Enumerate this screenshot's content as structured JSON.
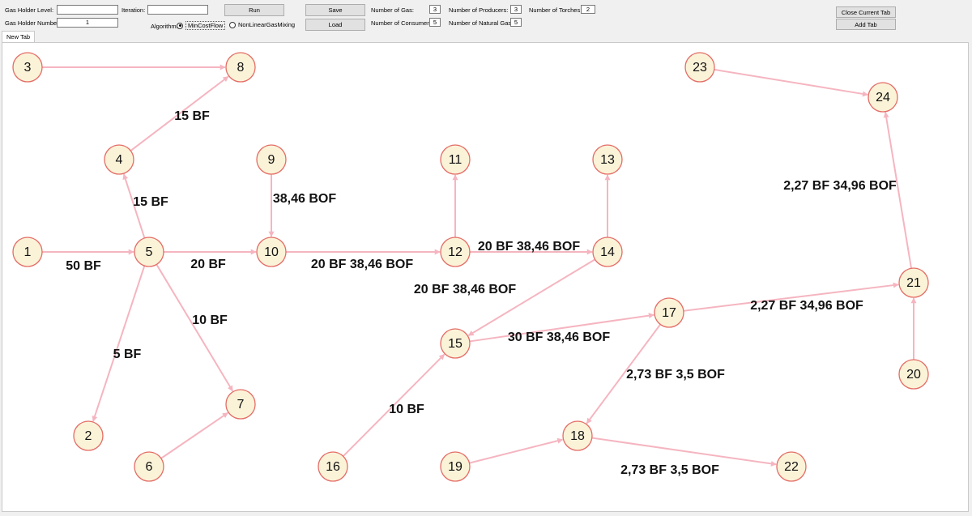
{
  "controls": {
    "gas_holder_level_label": "Gas Holder Level:",
    "gas_holder_level_value": "",
    "gas_holder_number_label": "Gas Holder Number:",
    "gas_holder_number_value": "1",
    "iteration_label": "Iteration:",
    "iteration_value": "",
    "algorithm_label": "Algorithm:",
    "algorithm_options": [
      "MinCostFlow",
      "NonLinearGasMixing"
    ],
    "algorithm_selected": "MinCostFlow",
    "run_label": "Run",
    "save_label": "Save",
    "load_label": "Load",
    "close_tab_label": "Close Current Tab",
    "add_tab_label": "Add Tab"
  },
  "stats": {
    "number_of_gas_label": "Number of Gas:",
    "number_of_gas": "3",
    "number_of_consumers_label": "Number of Consumers:",
    "number_of_consumers": "5",
    "number_of_producers_label": "Number of Producers:",
    "number_of_producers": "3",
    "number_of_natural_gas_label": "Number of Natural Gas:",
    "number_of_natural_gas": "5",
    "number_of_torches_label": "Number of Torches:",
    "number_of_torches": "2"
  },
  "tabs": [
    {
      "label": "New Tab"
    }
  ],
  "colors": {
    "node_fill": "#fbf3d8",
    "node_stroke": "#e46c66",
    "edge": "#f5b5c0"
  },
  "graph": {
    "nodes": [
      "1",
      "2",
      "3",
      "4",
      "5",
      "6",
      "7",
      "8",
      "9",
      "10",
      "11",
      "12",
      "13",
      "14",
      "15",
      "16",
      "17",
      "18",
      "19",
      "20",
      "21",
      "22",
      "23",
      "24"
    ],
    "edges": [
      {
        "from": "3",
        "to": "8",
        "label": ""
      },
      {
        "from": "4",
        "to": "8",
        "label": "15 BF"
      },
      {
        "from": "5",
        "to": "4",
        "label": "15 BF"
      },
      {
        "from": "1",
        "to": "5",
        "label": "50 BF"
      },
      {
        "from": "5",
        "to": "10",
        "label": "20 BF"
      },
      {
        "from": "9",
        "to": "10",
        "label": "38,46 BOF"
      },
      {
        "from": "10",
        "to": "12",
        "label": "20 BF 38,46 BOF"
      },
      {
        "from": "12",
        "to": "11",
        "label": ""
      },
      {
        "from": "12",
        "to": "14",
        "label": "20 BF 38,46 BOF"
      },
      {
        "from": "14",
        "to": "13",
        "label": ""
      },
      {
        "from": "14",
        "to": "15",
        "label": "20 BF 38,46 BOF"
      },
      {
        "from": "5",
        "to": "2",
        "label": "5 BF"
      },
      {
        "from": "5",
        "to": "7",
        "label": "10 BF"
      },
      {
        "from": "6",
        "to": "7",
        "label": ""
      },
      {
        "from": "16",
        "to": "15",
        "label": "10 BF"
      },
      {
        "from": "15",
        "to": "17",
        "label": "30 BF 38,46 BOF"
      },
      {
        "from": "17",
        "to": "21",
        "label": "2,27 BF 34,96 BOF"
      },
      {
        "from": "20",
        "to": "21",
        "label": ""
      },
      {
        "from": "21",
        "to": "24",
        "label": "2,27 BF 34,96 BOF"
      },
      {
        "from": "23",
        "to": "24",
        "label": ""
      },
      {
        "from": "17",
        "to": "18",
        "label": "2,73 BF 3,5 BOF"
      },
      {
        "from": "19",
        "to": "18",
        "label": ""
      },
      {
        "from": "18",
        "to": "22",
        "label": "2,73 BF 3,5 BOF"
      }
    ]
  }
}
